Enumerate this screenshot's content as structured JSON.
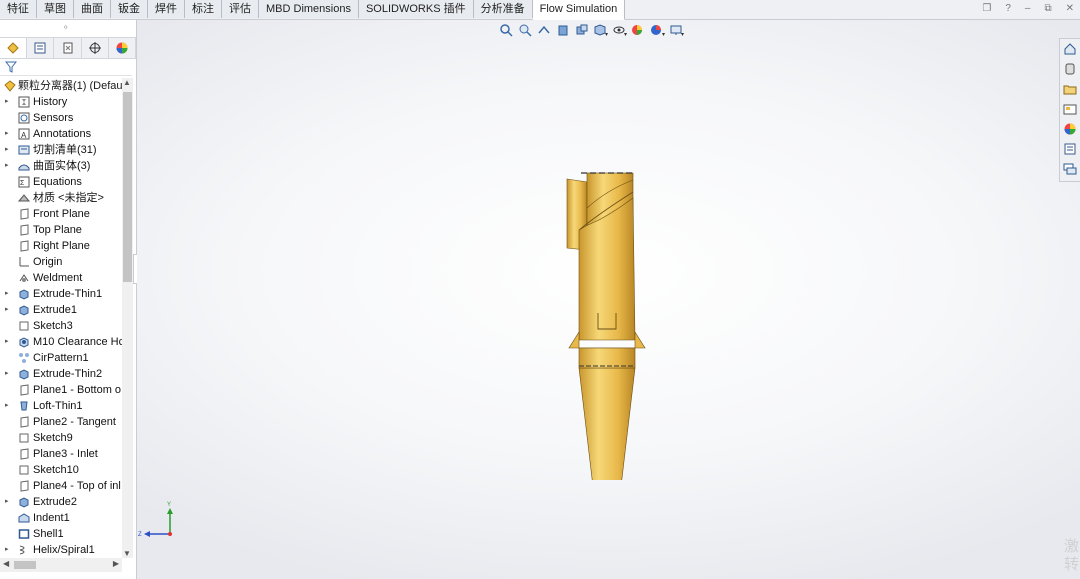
{
  "command_tabs": [
    "特征",
    "草图",
    "曲面",
    "钣金",
    "焊件",
    "标注",
    "评估",
    "MBD Dimensions",
    "SOLIDWORKS 插件",
    "分析准备",
    "Flow Simulation"
  ],
  "active_tab_index": 10,
  "feature_tree": {
    "root_label": "颗粒分离器(1)  (Defaul",
    "items": [
      {
        "label": "History",
        "expandable": true,
        "icon": "history-icon"
      },
      {
        "label": "Sensors",
        "expandable": false,
        "icon": "sensor-icon"
      },
      {
        "label": "Annotations",
        "expandable": true,
        "icon": "annotations-icon"
      },
      {
        "label": "切割清单(31)",
        "expandable": true,
        "icon": "cutlist-icon"
      },
      {
        "label": "曲面实体(3)",
        "expandable": true,
        "icon": "surface-bodies-icon"
      },
      {
        "label": "Equations",
        "expandable": false,
        "icon": "equations-icon"
      },
      {
        "label": "材质 <未指定>",
        "expandable": false,
        "icon": "material-icon"
      },
      {
        "label": "Front Plane",
        "expandable": false,
        "icon": "plane-icon"
      },
      {
        "label": "Top Plane",
        "expandable": false,
        "icon": "plane-icon"
      },
      {
        "label": "Right Plane",
        "expandable": false,
        "icon": "plane-icon"
      },
      {
        "label": "Origin",
        "expandable": false,
        "icon": "origin-icon"
      },
      {
        "label": "Weldment",
        "expandable": false,
        "icon": "weldment-icon"
      },
      {
        "label": "Extrude-Thin1",
        "expandable": true,
        "icon": "extrude-icon"
      },
      {
        "label": "Extrude1",
        "expandable": true,
        "icon": "extrude-icon"
      },
      {
        "label": "Sketch3",
        "expandable": false,
        "icon": "sketch-icon"
      },
      {
        "label": "M10 Clearance Hc",
        "expandable": true,
        "icon": "hole-icon"
      },
      {
        "label": "CirPattern1",
        "expandable": false,
        "icon": "pattern-icon"
      },
      {
        "label": "Extrude-Thin2",
        "expandable": true,
        "icon": "extrude-icon"
      },
      {
        "label": "Plane1 - Bottom o",
        "expandable": false,
        "icon": "plane-icon"
      },
      {
        "label": "Loft-Thin1",
        "expandable": true,
        "icon": "loft-icon"
      },
      {
        "label": "Plane2 - Tangent",
        "expandable": false,
        "icon": "plane-icon"
      },
      {
        "label": "Sketch9",
        "expandable": false,
        "icon": "sketch-icon"
      },
      {
        "label": "Plane3 - Inlet",
        "expandable": false,
        "icon": "plane-icon"
      },
      {
        "label": "Sketch10",
        "expandable": false,
        "icon": "sketch-icon"
      },
      {
        "label": "Plane4 - Top of inl",
        "expandable": false,
        "icon": "plane-icon"
      },
      {
        "label": "Extrude2",
        "expandable": true,
        "icon": "extrude-icon"
      },
      {
        "label": "Indent1",
        "expandable": false,
        "icon": "indent-icon"
      },
      {
        "label": "Shell1",
        "expandable": false,
        "icon": "shell-icon"
      },
      {
        "label": "Helix/Spiral1",
        "expandable": true,
        "icon": "helix-icon"
      }
    ]
  },
  "triad": {
    "x": "X",
    "y": "Y",
    "z": "Z"
  },
  "watermark": "激转",
  "colors": {
    "model_fill": "#e8b84a",
    "model_shade": "#c9962c",
    "model_light": "#f6d878",
    "tab_bg": "#e8ebef",
    "accent": "#2b6cb0"
  }
}
